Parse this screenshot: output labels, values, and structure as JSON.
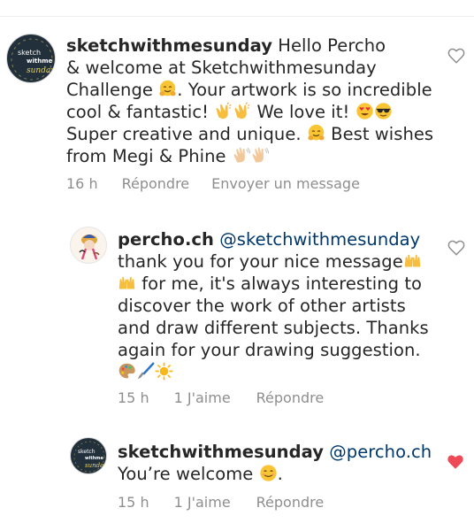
{
  "comments": [
    {
      "username": "sketchwithmesunday",
      "avatar_icon": "sketchwithmesunday-logo",
      "avatar_text": [
        "sketch",
        "withme",
        "sunday"
      ],
      "lines": [
        {
          "before": " Hello Percho"
        },
        {
          "before": "& welcome at Sketchwithmesunday"
        },
        {
          "before": "Challenge ",
          "emoji1": "hugging-face",
          "after": ". Your artwork is so incredible"
        },
        {
          "before": "cool & fantastic! ",
          "emoji1": "clapping-hands",
          "emoji2": "clapping-hands",
          "after": " We love it! ",
          "emoji3": "heart-eyes-face",
          "emoji4": "sunglasses-face"
        },
        {
          "before": "Super creative and unique. ",
          "emoji1": "hugging-face",
          "after": " Best wishes"
        },
        {
          "before": "from Megi & Phine ",
          "emoji1": "waving-hand",
          "emoji2": "waving-hand"
        }
      ],
      "time": "16 h",
      "reply_label": "Répondre",
      "message_label": "Envoyer un message",
      "liked": false
    },
    {
      "username": "percho.ch",
      "avatar_icon": "percho-avatar",
      "mention": "@sketchwithmesunday",
      "lines": [
        {
          "before": "thank you for your nice message",
          "emoji1": "raising-hands"
        },
        {
          "emoji1": "raising-hands",
          "after": " for me, it's always interesting  to"
        },
        {
          "before": "discover the work of other artists"
        },
        {
          "before": "and draw different  subjects. Thanks"
        },
        {
          "before": "again for your drawing suggestion."
        },
        {
          "emoji1": "artist-palette",
          "emoji2": "paintbrush",
          "emoji3": "sun"
        }
      ],
      "time": "15 h",
      "likes": "1 J'aime",
      "reply_label": "Répondre",
      "liked": false
    },
    {
      "username": "sketchwithmesunday",
      "avatar_icon": "sketchwithmesunday-logo",
      "avatar_text": [
        "sketch",
        "withme",
        "sunday"
      ],
      "mention": "@percho.ch",
      "lines": [
        {
          "before": "You’re welcome ",
          "emoji1": "smiling-face",
          "after": "."
        }
      ],
      "time": "15 h",
      "likes": "1 J'aime",
      "reply_label": "Répondre",
      "liked": true
    }
  ],
  "colors": {
    "text": "#262626",
    "meta": "#8e8e8e",
    "mention": "#00376b",
    "heart_liked": "#ed4956",
    "heart_outline": "#8e8e8e"
  }
}
